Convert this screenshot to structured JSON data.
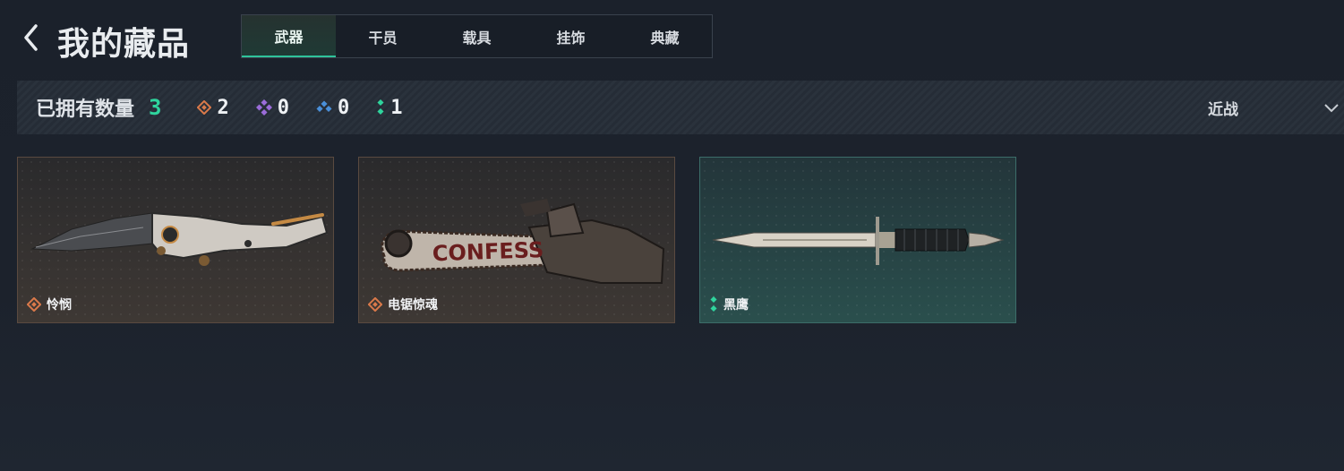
{
  "header": {
    "title": "我的藏品",
    "tabs": [
      {
        "label": "武器",
        "active": true
      },
      {
        "label": "干员",
        "active": false
      },
      {
        "label": "载具",
        "active": false
      },
      {
        "label": "挂饰",
        "active": false
      },
      {
        "label": "典藏",
        "active": false
      }
    ]
  },
  "stats": {
    "owned_label": "已拥有数量",
    "owned_total": "3",
    "rarities": [
      {
        "icon": "orange-diamond-icon",
        "color": "#d9794a",
        "count": "2"
      },
      {
        "icon": "purple-diamond-icon",
        "color": "#9b6cd9",
        "count": "0"
      },
      {
        "icon": "blue-diamond-icon",
        "color": "#4a8fd9",
        "count": "0"
      },
      {
        "icon": "green-diamond-icon",
        "color": "#2fd49d",
        "count": "1"
      }
    ],
    "filter": {
      "label": "近战"
    }
  },
  "items": [
    {
      "name": "怜悯",
      "rarity_icon": "orange-diamond-icon",
      "rarity_color": "#d9794a",
      "art": "folding-knife",
      "frame": "brown"
    },
    {
      "name": "电锯惊魂",
      "rarity_icon": "orange-diamond-icon",
      "rarity_color": "#d9794a",
      "art": "chainsaw",
      "art_text": "CONFESS",
      "frame": "brown"
    },
    {
      "name": "黑鹰",
      "rarity_icon": "green-diamond-icon",
      "rarity_color": "#2fd49d",
      "art": "dagger",
      "frame": "teal"
    }
  ]
}
